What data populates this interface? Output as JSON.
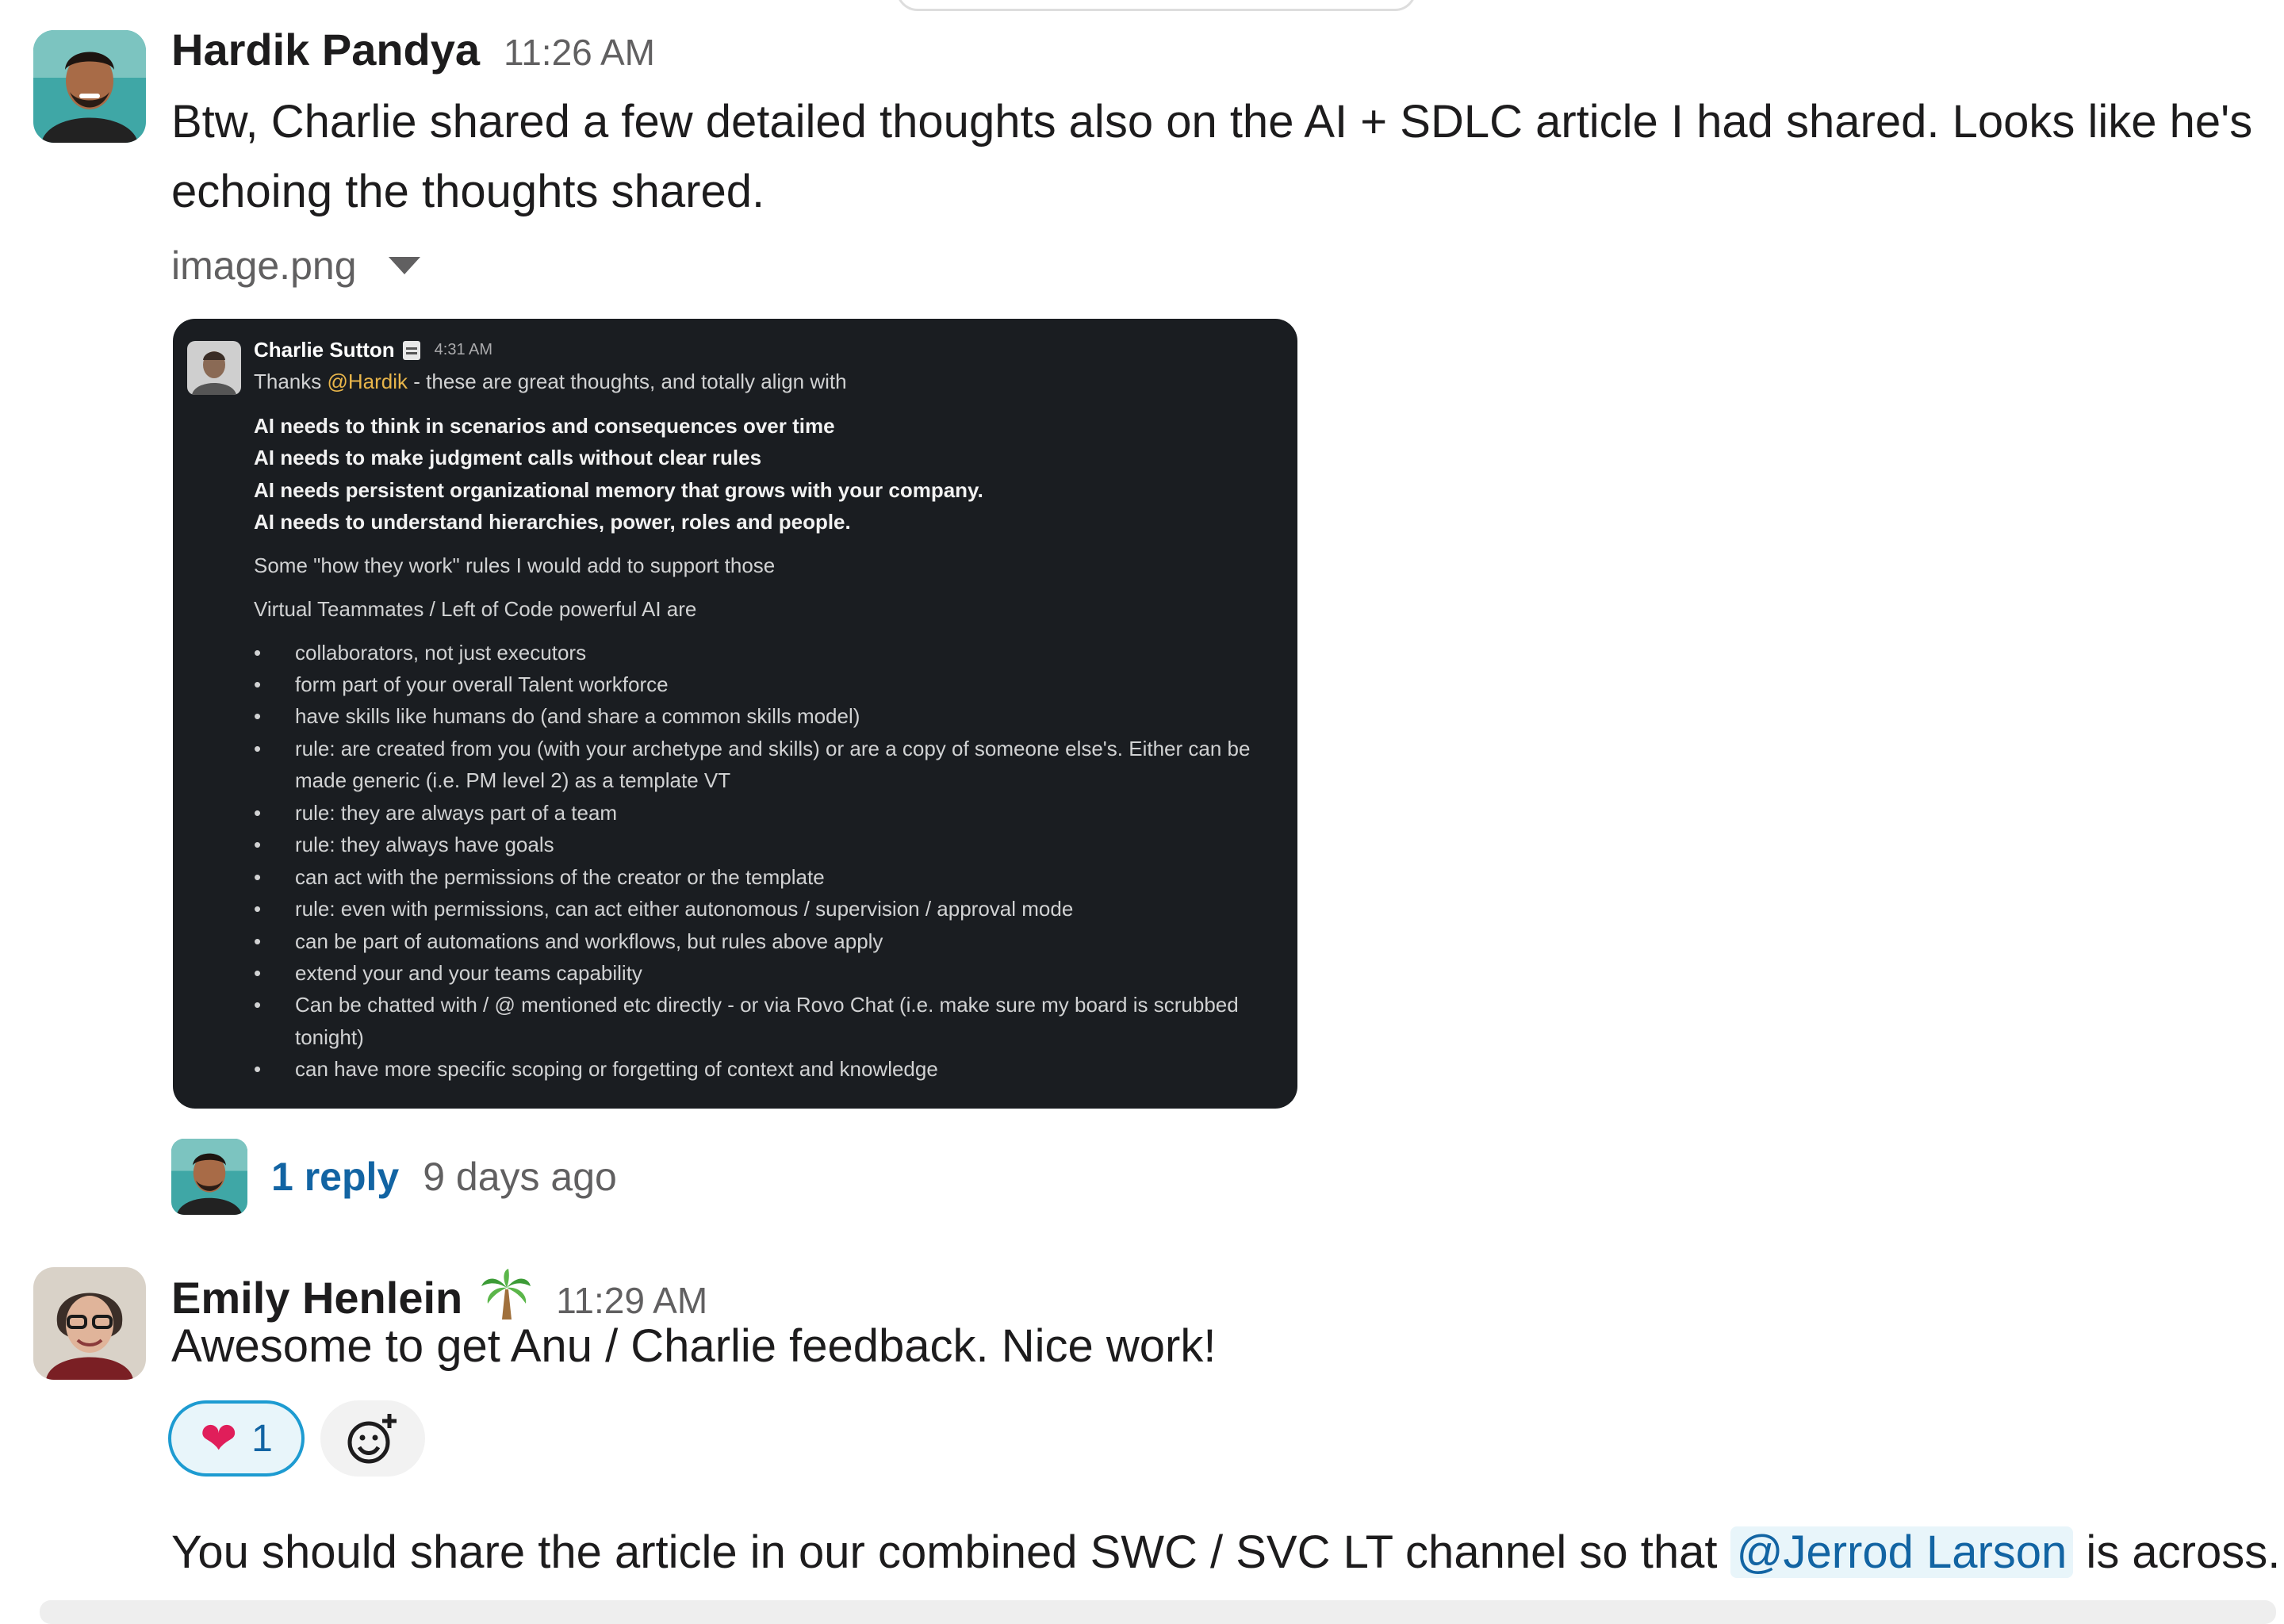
{
  "message1": {
    "author": "Hardik Pandya",
    "time": "11:26 AM",
    "text_line1": "Btw, Charlie shared a few detailed thoughts also on the AI + SDLC article I had shared. Looks like he's",
    "text_line2": "echoing the thoughts shared.",
    "attachment_name": "image.png",
    "attachment_toggle_icon": "caret-down-icon",
    "thread": {
      "reply_label": "1 reply",
      "last_reply": "9 days ago"
    }
  },
  "embedded_screenshot": {
    "author": "Charlie Sutton",
    "status_icon": "notepad-icon",
    "time": "4:31 AM",
    "greeting_prefix": "Thanks ",
    "greeting_mention": "@Hardik",
    "greeting_suffix": " - these are great thoughts, and totally align with",
    "bold_lines": [
      "AI needs to think in scenarios and consequences over time",
      "AI needs to make judgment calls without clear rules",
      "AI needs persistent organizational memory that grows with your company.",
      "AI needs to understand hierarchies, power, roles and people."
    ],
    "para1": "Some \"how they work\" rules I would add to support those",
    "para2": "Virtual Teammates / Left of Code powerful AI are",
    "bullets": [
      "collaborators, not just executors",
      "form part of your overall Talent workforce",
      "have skills like humans do (and share a common skills model)",
      "rule: are created from you (with your archetype and skills) or are a copy of someone else's. Either can be",
      "made generic (i.e. PM level 2) as a template VT",
      "rule: they are always part of a team",
      "rule: they always have goals",
      "can act with the permissions of the creator or the template",
      "rule: even with permissions, can act either autonomous / supervision / approval mode",
      "can be part of automations and workflows, but rules above apply",
      "extend your and your teams capability",
      "Can be chatted with / @ mentioned etc directly - or via Rovo Chat (i.e. make sure my board is scrubbed",
      "tonight)",
      "can have more specific scoping or forgetting of context and knowledge"
    ]
  },
  "message2": {
    "author": "Emily Henlein",
    "status_emoji": "palm-tree-icon",
    "time": "11:29 AM",
    "text": "Awesome to get Anu / Charlie feedback. Nice work!",
    "reaction": {
      "emoji": "heart-icon",
      "count": "1"
    },
    "add_reaction_icon": "add-reaction-icon"
  },
  "message3": {
    "text_before": "You should share the article in our combined SWC / SVC LT channel so that ",
    "mention": "@Jerrod Larson",
    "text_after": " is across."
  },
  "colors": {
    "link": "#1264a3",
    "reaction_border": "#1d9bd1",
    "reaction_bg": "#e8f5fa",
    "screenshot_bg": "#1a1d21",
    "mention_inner": "#e8b54a"
  }
}
